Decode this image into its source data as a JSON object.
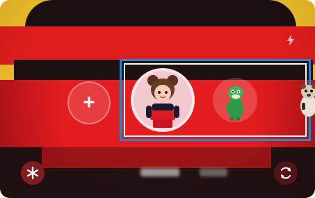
{
  "camera": {
    "add_label": "+",
    "settings_icon": "asterisk-icon",
    "flip_icon": "switch-camera-icon",
    "light_icon": "light-icon"
  },
  "emoji_tray": {
    "items": [
      {
        "icon": "plus-icon"
      },
      {
        "icon": "avatar-girl-icon"
      },
      {
        "icon": "avatar-dinosaur-icon"
      },
      {
        "icon": "avatar-animal-icon"
      }
    ]
  },
  "colors": {
    "highlight_outer": "#2a83c9",
    "highlight_inner": "#ffffff",
    "sweater_red": "#e21d1d",
    "background_yellow": "#f2c227"
  }
}
